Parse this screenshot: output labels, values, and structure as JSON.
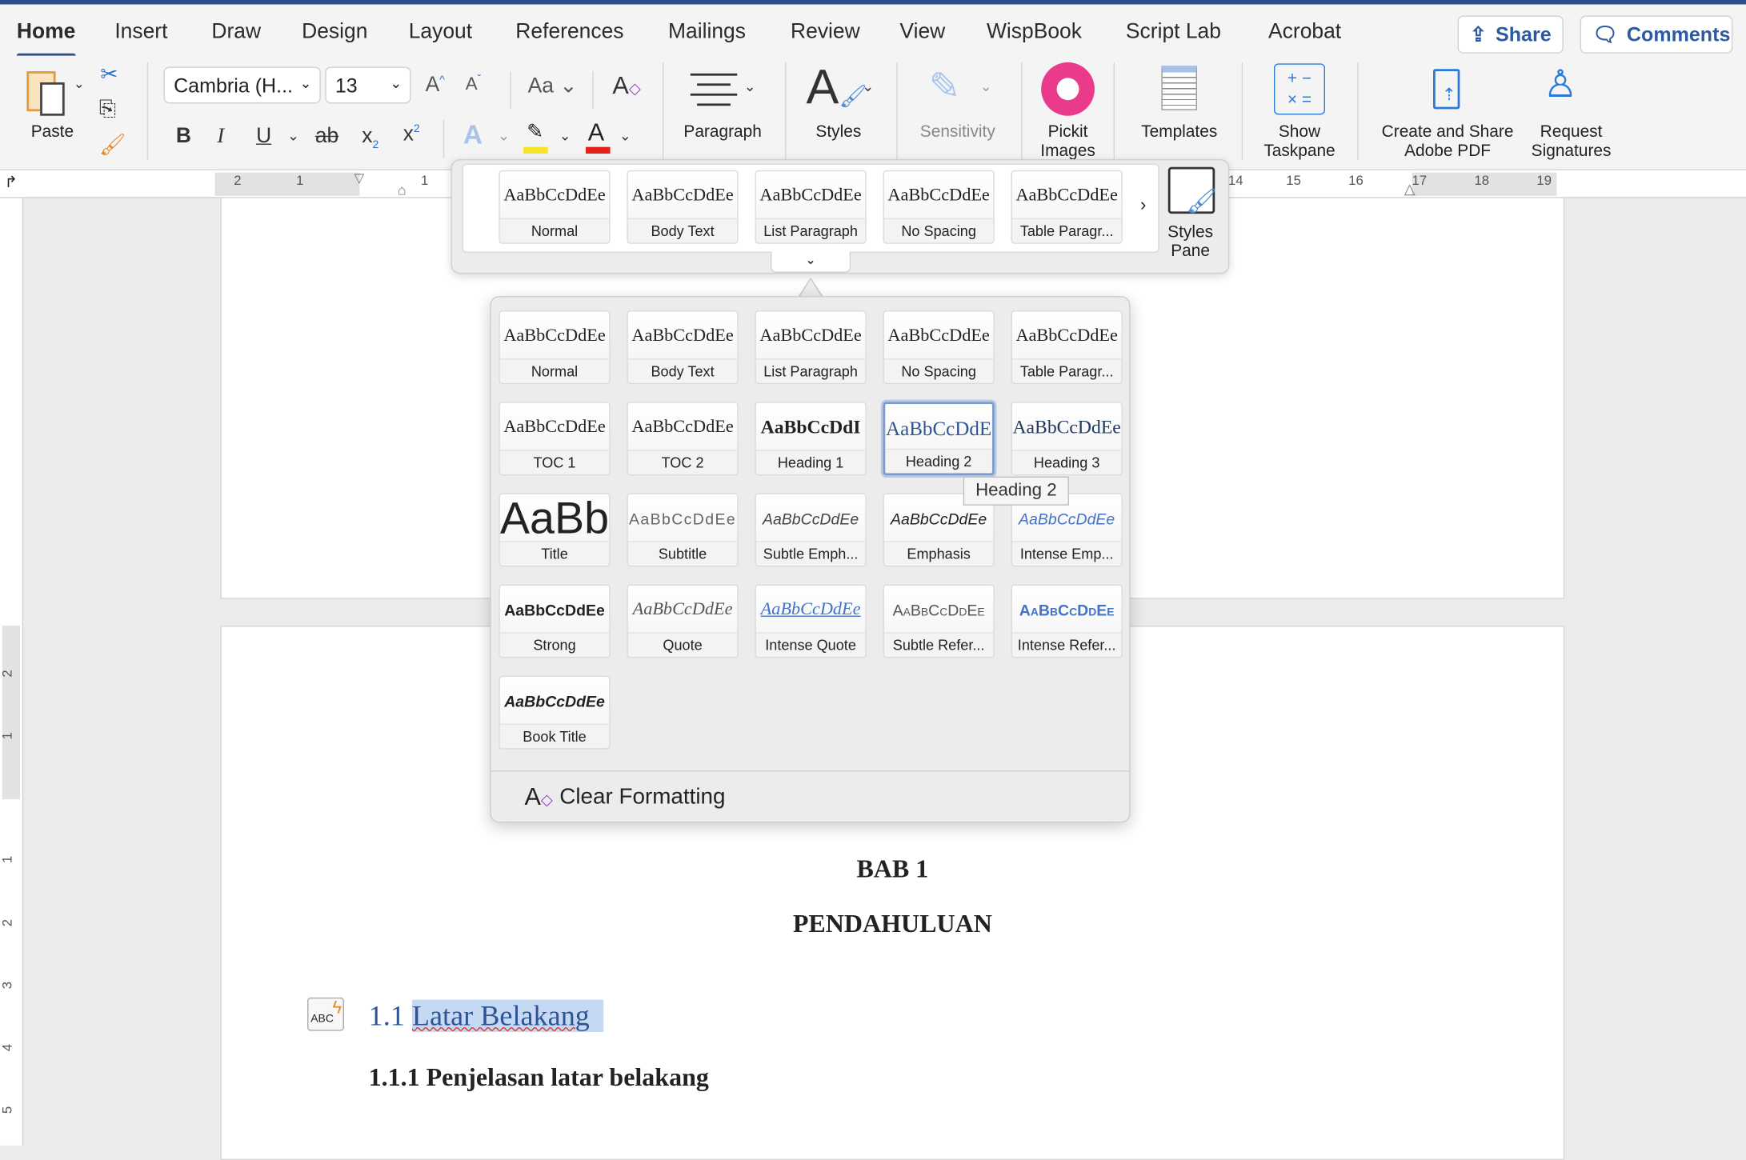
{
  "tabs": [
    "Home",
    "Insert",
    "Draw",
    "Design",
    "Layout",
    "References",
    "Mailings",
    "Review",
    "View",
    "WispBook",
    "Script Lab",
    "Acrobat"
  ],
  "active_tab": "Home",
  "header_buttons": {
    "share": "Share",
    "comments": "Comments"
  },
  "ribbon": {
    "paste": "Paste",
    "font_name": "Cambria (H...",
    "font_size": "13",
    "paragraph": "Paragraph",
    "styles": "Styles",
    "sensitivity": "Sensitivity",
    "pickit": "Pickit Images",
    "templates": "Templates",
    "show_taskpane": "Show Taskpane",
    "create_share_pdf": "Create and Share Adobe PDF",
    "request_signatures": "Request Signatures",
    "highlight_color": "#f5e52b",
    "font_color": "#e2231a"
  },
  "ruler": {
    "left_numbers": [
      "2",
      "1",
      "1"
    ],
    "right_numbers": [
      "14",
      "15",
      "16",
      "17",
      "18",
      "19"
    ],
    "vertical_numbers": [
      "2",
      "1",
      "1",
      "2",
      "3",
      "4",
      "5"
    ]
  },
  "gallery": {
    "preview": "AaBbCcDdEe",
    "items": [
      "Normal",
      "Body Text",
      "List Paragraph",
      "No Spacing",
      "Table Paragr..."
    ],
    "styles_pane": "Styles Pane"
  },
  "styles_panel": {
    "items": [
      {
        "name": "Normal",
        "preview": "AaBbCcDdEe"
      },
      {
        "name": "Body Text",
        "preview": "AaBbCcDdEe"
      },
      {
        "name": "List Paragraph",
        "preview": "AaBbCcDdEe"
      },
      {
        "name": "No Spacing",
        "preview": "AaBbCcDdEe"
      },
      {
        "name": "Table Paragr...",
        "preview": "AaBbCcDdEe"
      },
      {
        "name": "TOC 1",
        "preview": "AaBbCcDdEe"
      },
      {
        "name": "TOC 2",
        "preview": "AaBbCcDdEe"
      },
      {
        "name": "Heading 1",
        "preview": "AaBbCcDdI"
      },
      {
        "name": "Heading 2",
        "preview": "AaBbCcDdE"
      },
      {
        "name": "Heading 3",
        "preview": "AaBbCcDdEe"
      },
      {
        "name": "Title",
        "preview": "AaBb"
      },
      {
        "name": "Subtitle",
        "preview": "AaBbCcDdEe"
      },
      {
        "name": "Subtle Emph...",
        "preview": "AaBbCcDdEe"
      },
      {
        "name": "Emphasis",
        "preview": "AaBbCcDdEe"
      },
      {
        "name": "Intense Emp...",
        "preview": "AaBbCcDdEe"
      },
      {
        "name": "Strong",
        "preview": "AaBbCcDdEe"
      },
      {
        "name": "Quote",
        "preview": "AaBbCcDdEe"
      },
      {
        "name": "Intense Quote",
        "preview": "AaBbCcDdEe"
      },
      {
        "name": "Subtle Refer...",
        "preview": "AaBbCcDdEe"
      },
      {
        "name": "Intense Refer...",
        "preview": "AaBbCcDdEe"
      },
      {
        "name": "Book Title",
        "preview": "AaBbCcDdEe"
      }
    ],
    "selected": "Heading 2",
    "tooltip": "Heading 2",
    "clear_formatting": "Clear Formatting"
  },
  "document": {
    "chapter": "BAB 1",
    "chapter_title": "PENDAHULUAN",
    "heading_number": "1.1",
    "heading_text": "Latar Belakang",
    "subheading": "1.1.1 Penjelasan latar belakang",
    "heading_color": "#2f5496"
  }
}
